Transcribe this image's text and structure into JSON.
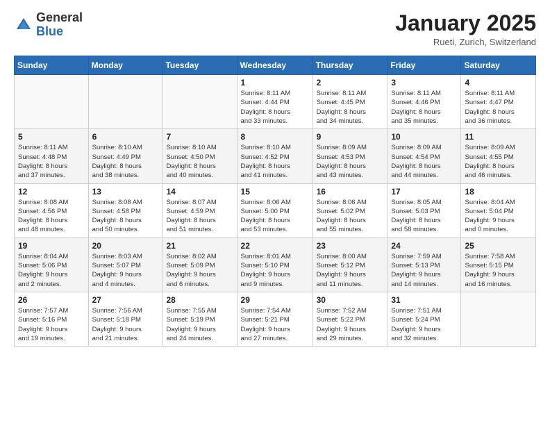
{
  "header": {
    "logo_general": "General",
    "logo_blue": "Blue",
    "month_title": "January 2025",
    "location": "Rueti, Zurich, Switzerland"
  },
  "weekdays": [
    "Sunday",
    "Monday",
    "Tuesday",
    "Wednesday",
    "Thursday",
    "Friday",
    "Saturday"
  ],
  "weeks": [
    [
      {
        "day": "",
        "info": ""
      },
      {
        "day": "",
        "info": ""
      },
      {
        "day": "",
        "info": ""
      },
      {
        "day": "1",
        "info": "Sunrise: 8:11 AM\nSunset: 4:44 PM\nDaylight: 8 hours\nand 33 minutes."
      },
      {
        "day": "2",
        "info": "Sunrise: 8:11 AM\nSunset: 4:45 PM\nDaylight: 8 hours\nand 34 minutes."
      },
      {
        "day": "3",
        "info": "Sunrise: 8:11 AM\nSunset: 4:46 PM\nDaylight: 8 hours\nand 35 minutes."
      },
      {
        "day": "4",
        "info": "Sunrise: 8:11 AM\nSunset: 4:47 PM\nDaylight: 8 hours\nand 36 minutes."
      }
    ],
    [
      {
        "day": "5",
        "info": "Sunrise: 8:11 AM\nSunset: 4:48 PM\nDaylight: 8 hours\nand 37 minutes."
      },
      {
        "day": "6",
        "info": "Sunrise: 8:10 AM\nSunset: 4:49 PM\nDaylight: 8 hours\nand 38 minutes."
      },
      {
        "day": "7",
        "info": "Sunrise: 8:10 AM\nSunset: 4:50 PM\nDaylight: 8 hours\nand 40 minutes."
      },
      {
        "day": "8",
        "info": "Sunrise: 8:10 AM\nSunset: 4:52 PM\nDaylight: 8 hours\nand 41 minutes."
      },
      {
        "day": "9",
        "info": "Sunrise: 8:09 AM\nSunset: 4:53 PM\nDaylight: 8 hours\nand 43 minutes."
      },
      {
        "day": "10",
        "info": "Sunrise: 8:09 AM\nSunset: 4:54 PM\nDaylight: 8 hours\nand 44 minutes."
      },
      {
        "day": "11",
        "info": "Sunrise: 8:09 AM\nSunset: 4:55 PM\nDaylight: 8 hours\nand 46 minutes."
      }
    ],
    [
      {
        "day": "12",
        "info": "Sunrise: 8:08 AM\nSunset: 4:56 PM\nDaylight: 8 hours\nand 48 minutes."
      },
      {
        "day": "13",
        "info": "Sunrise: 8:08 AM\nSunset: 4:58 PM\nDaylight: 8 hours\nand 50 minutes."
      },
      {
        "day": "14",
        "info": "Sunrise: 8:07 AM\nSunset: 4:59 PM\nDaylight: 8 hours\nand 51 minutes."
      },
      {
        "day": "15",
        "info": "Sunrise: 8:06 AM\nSunset: 5:00 PM\nDaylight: 8 hours\nand 53 minutes."
      },
      {
        "day": "16",
        "info": "Sunrise: 8:06 AM\nSunset: 5:02 PM\nDaylight: 8 hours\nand 55 minutes."
      },
      {
        "day": "17",
        "info": "Sunrise: 8:05 AM\nSunset: 5:03 PM\nDaylight: 8 hours\nand 58 minutes."
      },
      {
        "day": "18",
        "info": "Sunrise: 8:04 AM\nSunset: 5:04 PM\nDaylight: 9 hours\nand 0 minutes."
      }
    ],
    [
      {
        "day": "19",
        "info": "Sunrise: 8:04 AM\nSunset: 5:06 PM\nDaylight: 9 hours\nand 2 minutes."
      },
      {
        "day": "20",
        "info": "Sunrise: 8:03 AM\nSunset: 5:07 PM\nDaylight: 9 hours\nand 4 minutes."
      },
      {
        "day": "21",
        "info": "Sunrise: 8:02 AM\nSunset: 5:09 PM\nDaylight: 9 hours\nand 6 minutes."
      },
      {
        "day": "22",
        "info": "Sunrise: 8:01 AM\nSunset: 5:10 PM\nDaylight: 9 hours\nand 9 minutes."
      },
      {
        "day": "23",
        "info": "Sunrise: 8:00 AM\nSunset: 5:12 PM\nDaylight: 9 hours\nand 11 minutes."
      },
      {
        "day": "24",
        "info": "Sunrise: 7:59 AM\nSunset: 5:13 PM\nDaylight: 9 hours\nand 14 minutes."
      },
      {
        "day": "25",
        "info": "Sunrise: 7:58 AM\nSunset: 5:15 PM\nDaylight: 9 hours\nand 16 minutes."
      }
    ],
    [
      {
        "day": "26",
        "info": "Sunrise: 7:57 AM\nSunset: 5:16 PM\nDaylight: 9 hours\nand 19 minutes."
      },
      {
        "day": "27",
        "info": "Sunrise: 7:56 AM\nSunset: 5:18 PM\nDaylight: 9 hours\nand 21 minutes."
      },
      {
        "day": "28",
        "info": "Sunrise: 7:55 AM\nSunset: 5:19 PM\nDaylight: 9 hours\nand 24 minutes."
      },
      {
        "day": "29",
        "info": "Sunrise: 7:54 AM\nSunset: 5:21 PM\nDaylight: 9 hours\nand 27 minutes."
      },
      {
        "day": "30",
        "info": "Sunrise: 7:52 AM\nSunset: 5:22 PM\nDaylight: 9 hours\nand 29 minutes."
      },
      {
        "day": "31",
        "info": "Sunrise: 7:51 AM\nSunset: 5:24 PM\nDaylight: 9 hours\nand 32 minutes."
      },
      {
        "day": "",
        "info": ""
      }
    ]
  ]
}
